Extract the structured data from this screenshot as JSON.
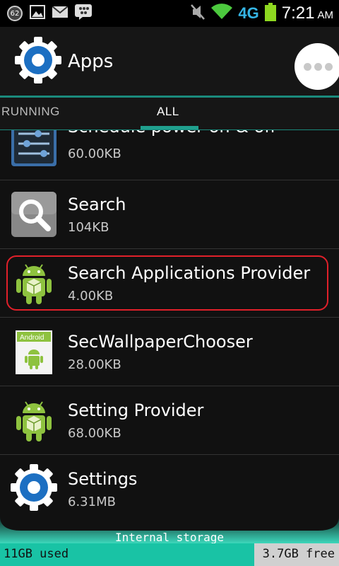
{
  "status_bar": {
    "badge_count": "62",
    "network": "4G",
    "time": "7:21",
    "ampm": "AM",
    "icons": [
      "notification-count-icon",
      "image-icon",
      "mail-icon",
      "bbm-icon",
      "mute-icon",
      "wifi-icon",
      "battery-icon"
    ]
  },
  "header": {
    "title": "Apps"
  },
  "tabs": {
    "running": "RUNNING",
    "all": "ALL"
  },
  "apps": [
    {
      "name": "Schedule power on & off",
      "size": "60.00KB",
      "icon": "schedule-power-icon"
    },
    {
      "name": "Search",
      "size": "104KB",
      "icon": "search-app-icon"
    },
    {
      "name": "Search Applications Provider",
      "size": "4.00KB",
      "icon": "android-icon"
    },
    {
      "name": "SecWallpaperChooser",
      "size": "28.00KB",
      "icon": "wallpaper-chooser-icon"
    },
    {
      "name": "Setting Provider",
      "size": "68.00KB",
      "icon": "android-icon"
    },
    {
      "name": "Settings",
      "size": "6.31MB",
      "icon": "settings-gear-icon"
    }
  ],
  "storage": {
    "label": "Internal storage",
    "used": "11GB used",
    "free": "3.7GB free",
    "used_fraction": 0.75
  },
  "colors": {
    "accent": "#20a08e",
    "highlight_border": "#e0202a",
    "storage_used": "#19c3a5",
    "network": "#35b5e5",
    "battery": "#8ed820"
  }
}
